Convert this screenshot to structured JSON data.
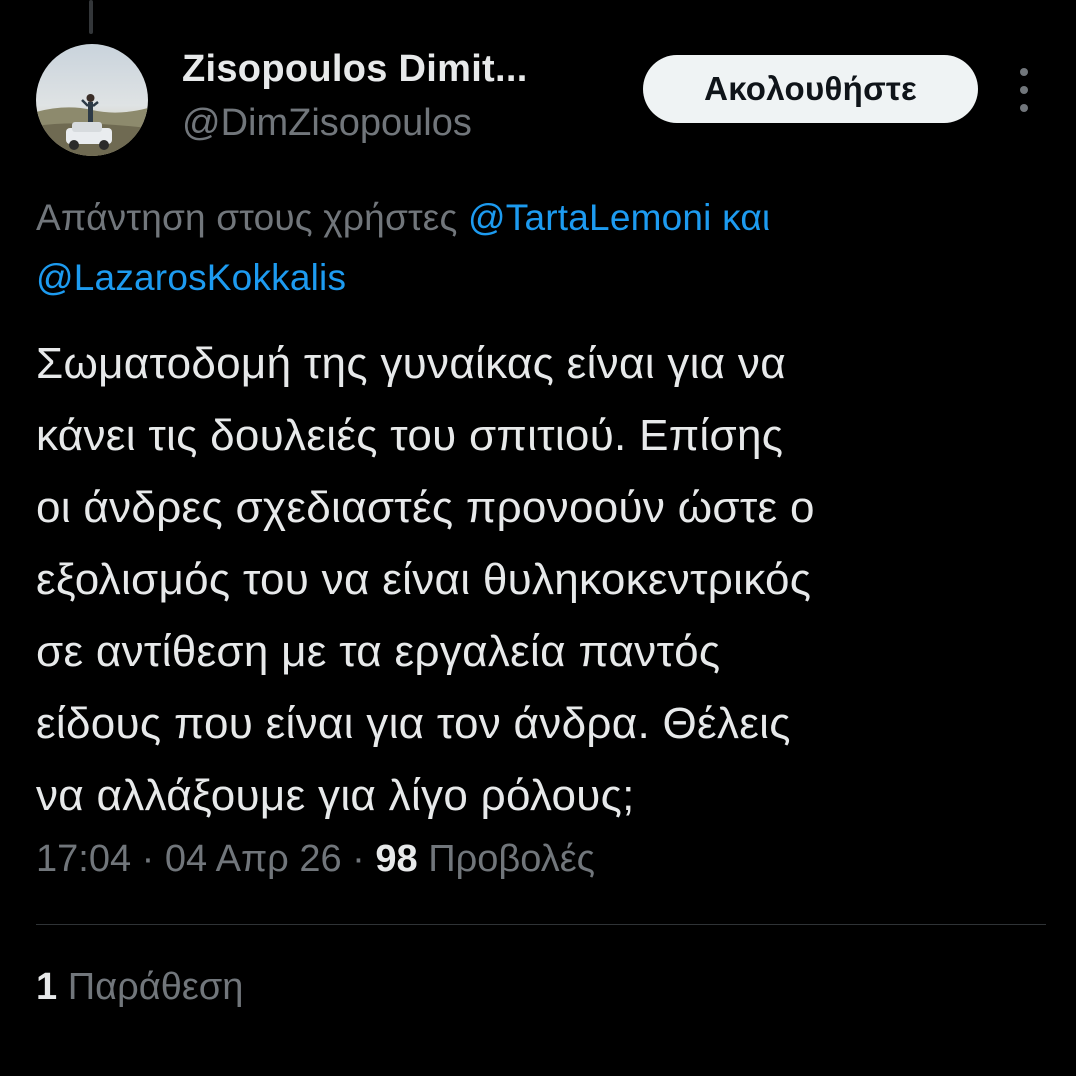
{
  "author": {
    "display_name": "Zisopoulos Dimit...",
    "handle": "@DimZisopoulos"
  },
  "follow_button": {
    "label": "Ακολουθήστε"
  },
  "more_icon": "more-vertical-icon",
  "reply_context": {
    "prefix": "Απάντηση στους χρήστες",
    "mention_1": "@TartaLemoni",
    "connector": "και",
    "mention_2": "@LazarosKokkalis"
  },
  "tweet": {
    "lines": [
      "Σωματοδομή της γυναίκας είναι για να",
      "κάνει τις δουλειές του σπιτιού. Επίσης",
      "οι άνδρες σχεδιαστές προνοούν ώστε ο",
      "εξολισμός του να είναι θυληκοκεντρικός",
      "σε αντίθεση με τα εργαλεία παντός",
      "είδους που είναι για τον άνδρα. Θέλεις",
      "να αλλάξουμε για λίγο ρόλους;"
    ]
  },
  "meta": {
    "time": "17:04",
    "date": "04 Απρ 26",
    "views_count": "98",
    "views_label": "Προβολές"
  },
  "engagement": {
    "quotes_count": "1",
    "quotes_label": "Παράθεση"
  },
  "colors": {
    "background": "#000000",
    "text_primary": "#e7e9ea",
    "text_secondary": "#71767b",
    "link": "#1d9bf0",
    "button_bg": "#eff3f4",
    "divider": "#2f3336"
  }
}
